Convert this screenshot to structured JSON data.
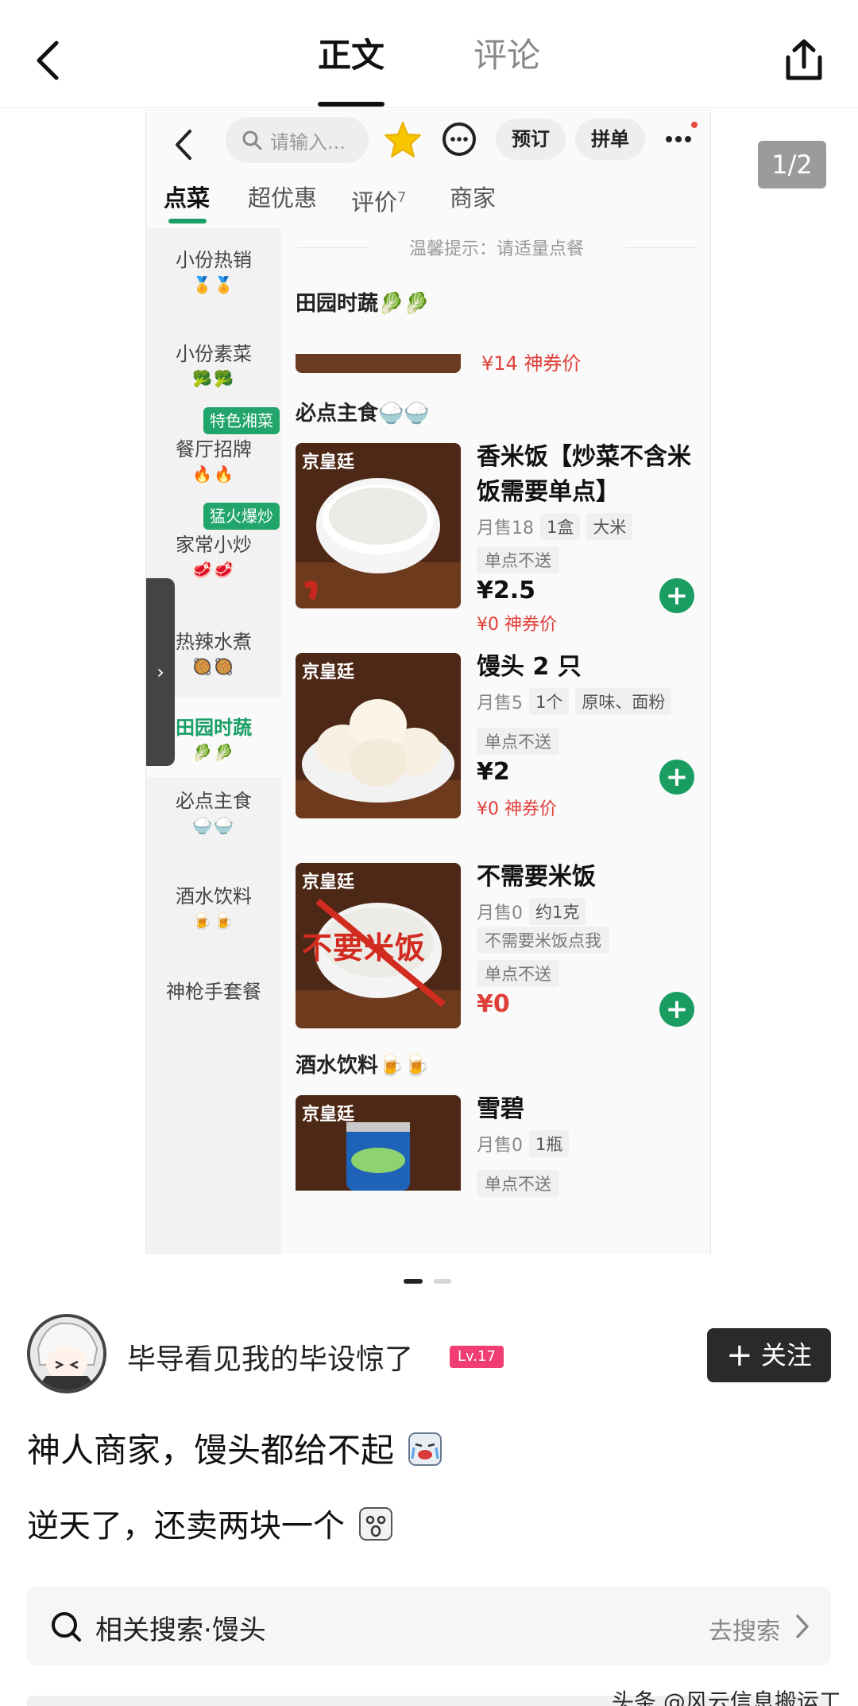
{
  "nav": {
    "tab_main": "正文",
    "tab_comment": "评论"
  },
  "page_counter": "1/2",
  "phone": {
    "search_placeholder": "请输入...",
    "pill_reserve": "预订",
    "pill_group": "拼单",
    "tabs": [
      {
        "label": "点菜"
      },
      {
        "label": "超优惠"
      },
      {
        "label": "评价",
        "count": "7"
      },
      {
        "label": "商家"
      }
    ],
    "sidebar": [
      {
        "label": "小份热销",
        "emoji": "🏅🏅"
      },
      {
        "label": "小份素菜",
        "emoji": "🥦🥦"
      },
      {
        "label": "餐厅招牌",
        "emoji": "🔥🔥",
        "badge": "特色湘菜"
      },
      {
        "label": "家常小炒",
        "emoji": "🥩🥩",
        "badge": "猛火爆炒"
      },
      {
        "label": "热辣水煮",
        "emoji": "🥘🥘"
      },
      {
        "label": "田园时蔬",
        "emoji": "🥬🥬"
      },
      {
        "label": "必点主食",
        "emoji": "🍚🍚"
      },
      {
        "label": "酒水饮料",
        "emoji": "🍺🍺"
      },
      {
        "label": "神枪手套餐"
      }
    ],
    "tip": "温馨提示：请适量点餐",
    "section_veg": {
      "title": "田园时蔬",
      "emoji": "🥬🥬",
      "cut_price": "¥14 神券价"
    },
    "section_staple": {
      "title": "必点主食",
      "emoji": "🍚🍚"
    },
    "section_drink": {
      "title": "酒水饮料",
      "emoji": "🍺🍺"
    },
    "img_logo": "京皇廷",
    "items": [
      {
        "name": "香米饭【炒菜不含米饭需要单点】",
        "sales": "月售18",
        "tags": [
          "1盒",
          "大米"
        ],
        "no_single": "单点不送",
        "price": "¥2.5",
        "coupon": "¥0 神券价"
      },
      {
        "name": "馒头 2 只",
        "sales": "月售5",
        "tags": [
          "1个",
          "原味、面粉"
        ],
        "no_single": "单点不送",
        "price": "¥2",
        "coupon": "¥0 神券价"
      },
      {
        "name": "不需要米饭",
        "sales": "月售0",
        "tags": [
          "约1克"
        ],
        "tag_line2": "不需要米饭点我",
        "no_single": "单点不送",
        "price": "¥0",
        "img_text": "不要米饭"
      },
      {
        "name": "雪碧",
        "sales": "月售0",
        "tags": [
          "1瓶"
        ],
        "no_single": "单点不送"
      }
    ]
  },
  "author": {
    "name": "毕导看见我的毕设惊了",
    "level": "Lv.17",
    "follow_label": "关注"
  },
  "post": {
    "line1": "神人商家，馒头都给不起",
    "line2": "逆天了，还卖两块一个"
  },
  "related": {
    "label": "相关搜索·馒头",
    "go": "去搜索"
  },
  "watermark": "头条 @风云信息搬运工",
  "colors": {
    "green": "#1a9d60",
    "red": "#e0403a",
    "level_pink": "#f03e74"
  }
}
